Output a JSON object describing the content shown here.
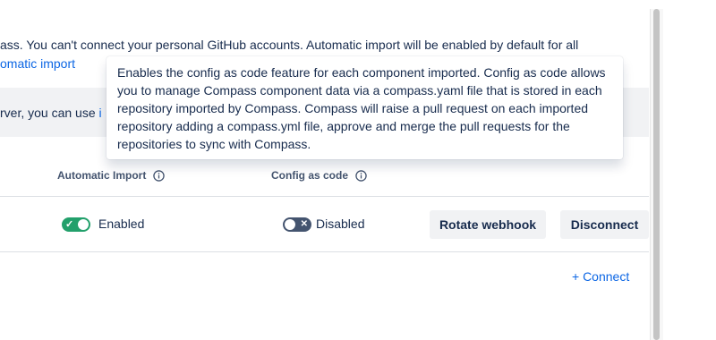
{
  "intro": {
    "line1": "ass. You can't connect your personal GitHub accounts. Automatic import will be enabled by default for all",
    "line2": "omatic import"
  },
  "info_banner": {
    "text": "rver, you can use ",
    "link": "i"
  },
  "columns": {
    "automatic_import": "Automatic Import",
    "config_as_code": "Config as code"
  },
  "row": {
    "automatic_import_status": "Enabled",
    "automatic_import_enabled": true,
    "config_as_code_status": "Disabled",
    "config_as_code_enabled": false,
    "rotate_webhook": "Rotate webhook",
    "disconnect": "Disconnect"
  },
  "connect_link": "+ Connect",
  "tooltip": {
    "text": "Enables the config as code feature for each component imported. Config as code allows you to manage Compass component data via a compass.yaml file that is stored in each repository imported by Compass. Compass will raise a pull request on each imported repository adding a compass.yml file, approve and merge the pull requests for the repositories to sync with Compass."
  },
  "icons": {
    "info": "info-icon",
    "check": "check-icon",
    "close": "close-icon"
  },
  "colors": {
    "link": "#0c66e4",
    "toggle_on": "#22a06b",
    "toggle_off": "#44546f",
    "button_bg": "#f1f2f4"
  }
}
